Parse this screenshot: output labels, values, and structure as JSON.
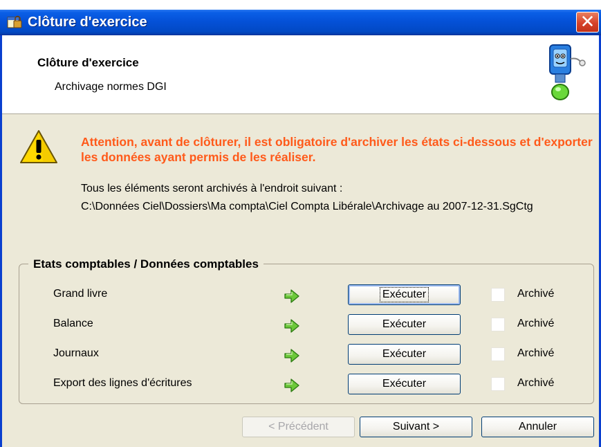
{
  "window": {
    "title": "Clôture d'exercice",
    "close_label": "✕"
  },
  "header": {
    "title": "Clôture d'exercice",
    "subtitle": "Archivage normes DGI"
  },
  "warning": {
    "text": "Attention, avant de clôturer, il est obligatoire d'archiver les états ci-dessous et d'exporter les données ayant permis de les réaliser."
  },
  "info": {
    "text": "Tous les éléments seront archivés à l'endroit suivant :",
    "path": "C:\\Données Ciel\\Dossiers\\Ma compta\\Ciel Compta Libérale\\Archivage au 2007-12-31.SgCtg"
  },
  "group": {
    "legend": "Etats comptables / Données comptables",
    "rows": [
      {
        "label": "Grand livre",
        "button": "Exécuter",
        "check_label": "Archivé",
        "checked": false
      },
      {
        "label": "Balance",
        "button": "Exécuter",
        "check_label": "Archivé",
        "checked": false
      },
      {
        "label": "Journaux",
        "button": "Exécuter",
        "check_label": "Archivé",
        "checked": false
      },
      {
        "label": "Export des lignes d'écritures",
        "button": "Exécuter",
        "check_label": "Archivé",
        "checked": false
      }
    ]
  },
  "footer": {
    "prev_label": "< Précédent",
    "next_label": "Suivant >",
    "cancel_label": "Annuler"
  },
  "colors": {
    "titlebar": "#0450d6",
    "warning_text": "#ff5a1a",
    "dialog_bg": "#ece9d8",
    "close_button": "#d6422a"
  }
}
